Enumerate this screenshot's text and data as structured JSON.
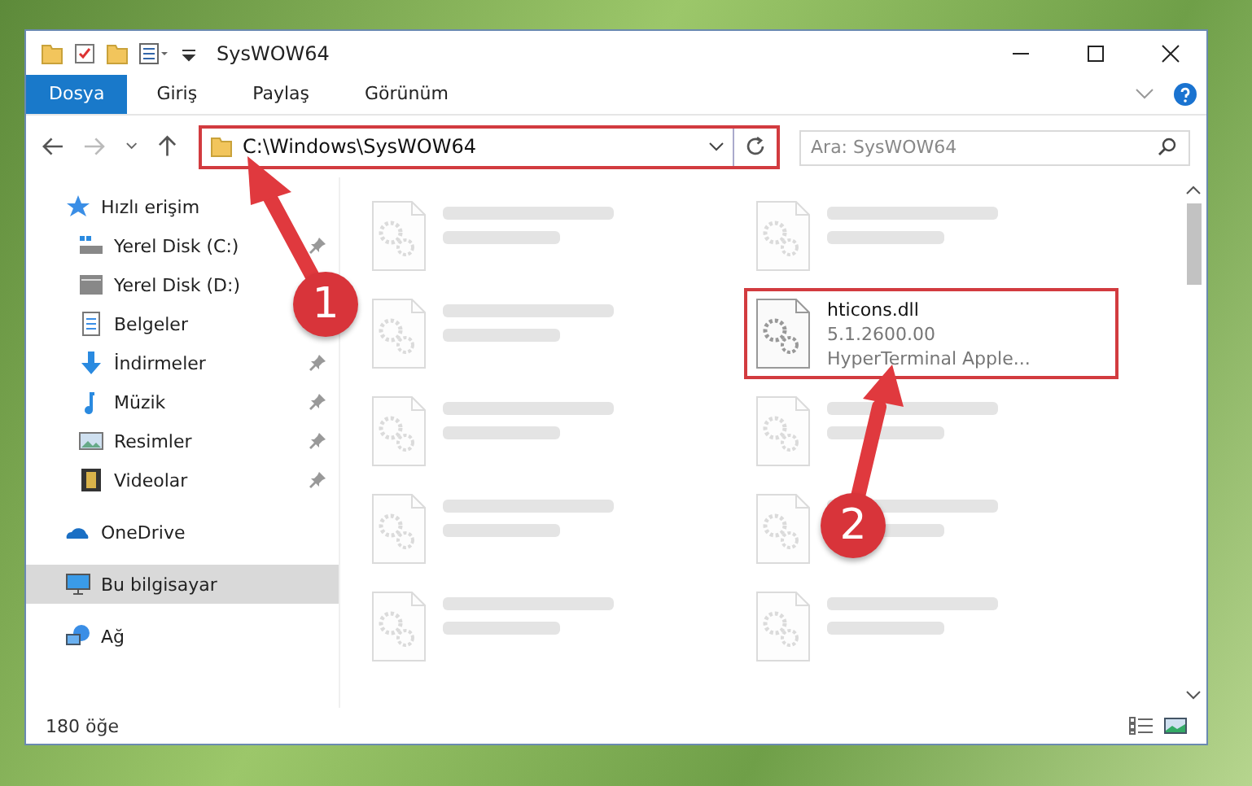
{
  "window": {
    "title": "SysWOW64"
  },
  "ribbon_tabs": [
    {
      "label": "Dosya",
      "selected": true
    },
    {
      "label": "Giriş",
      "selected": false
    },
    {
      "label": "Paylaş",
      "selected": false
    },
    {
      "label": "Görünüm",
      "selected": false
    }
  ],
  "address": {
    "path": "C:\\Windows\\SysWOW64"
  },
  "search": {
    "placeholder": "Ara: SysWOW64"
  },
  "sidebar": {
    "items": [
      {
        "label": "Hızlı erişim",
        "kind": "star",
        "pinned": false,
        "selected": false,
        "group": true
      },
      {
        "label": "Yerel Disk (C:)",
        "kind": "disk-c",
        "pinned": true,
        "selected": false,
        "group": false
      },
      {
        "label": "Yerel Disk (D:)",
        "kind": "disk",
        "pinned": false,
        "selected": false,
        "group": false
      },
      {
        "label": "Belgeler",
        "kind": "doc",
        "pinned": false,
        "selected": false,
        "group": false
      },
      {
        "label": "İndirmeler",
        "kind": "download",
        "pinned": true,
        "selected": false,
        "group": false
      },
      {
        "label": "Müzik",
        "kind": "music",
        "pinned": true,
        "selected": false,
        "group": false
      },
      {
        "label": "Resimler",
        "kind": "picture",
        "pinned": true,
        "selected": false,
        "group": false
      },
      {
        "label": "Videolar",
        "kind": "video",
        "pinned": true,
        "selected": false,
        "group": false
      },
      {
        "label": "OneDrive",
        "kind": "cloud",
        "pinned": false,
        "selected": false,
        "group": true
      },
      {
        "label": "Bu bilgisayar",
        "kind": "pc",
        "pinned": false,
        "selected": true,
        "group": true
      },
      {
        "label": "Ağ",
        "kind": "network",
        "pinned": false,
        "selected": false,
        "group": true
      }
    ]
  },
  "files": [
    {
      "blurred": true,
      "highlighted": false
    },
    {
      "blurred": true,
      "highlighted": false
    },
    {
      "blurred": true,
      "highlighted": false
    },
    {
      "name": "hticons.dll",
      "line_2": "5.1.2600.00",
      "line_3": "HyperTerminal Apple...",
      "blurred": false,
      "highlighted": true
    },
    {
      "blurred": true,
      "highlighted": false
    },
    {
      "blurred": true,
      "highlighted": false
    },
    {
      "blurred": true,
      "highlighted": false
    },
    {
      "blurred": true,
      "highlighted": false
    },
    {
      "blurred": true,
      "highlighted": false
    },
    {
      "blurred": true,
      "highlighted": false
    }
  ],
  "status_bar": {
    "count": "180 öğe"
  },
  "annotations": [
    {
      "label": "1"
    },
    {
      "label": "2"
    }
  ]
}
